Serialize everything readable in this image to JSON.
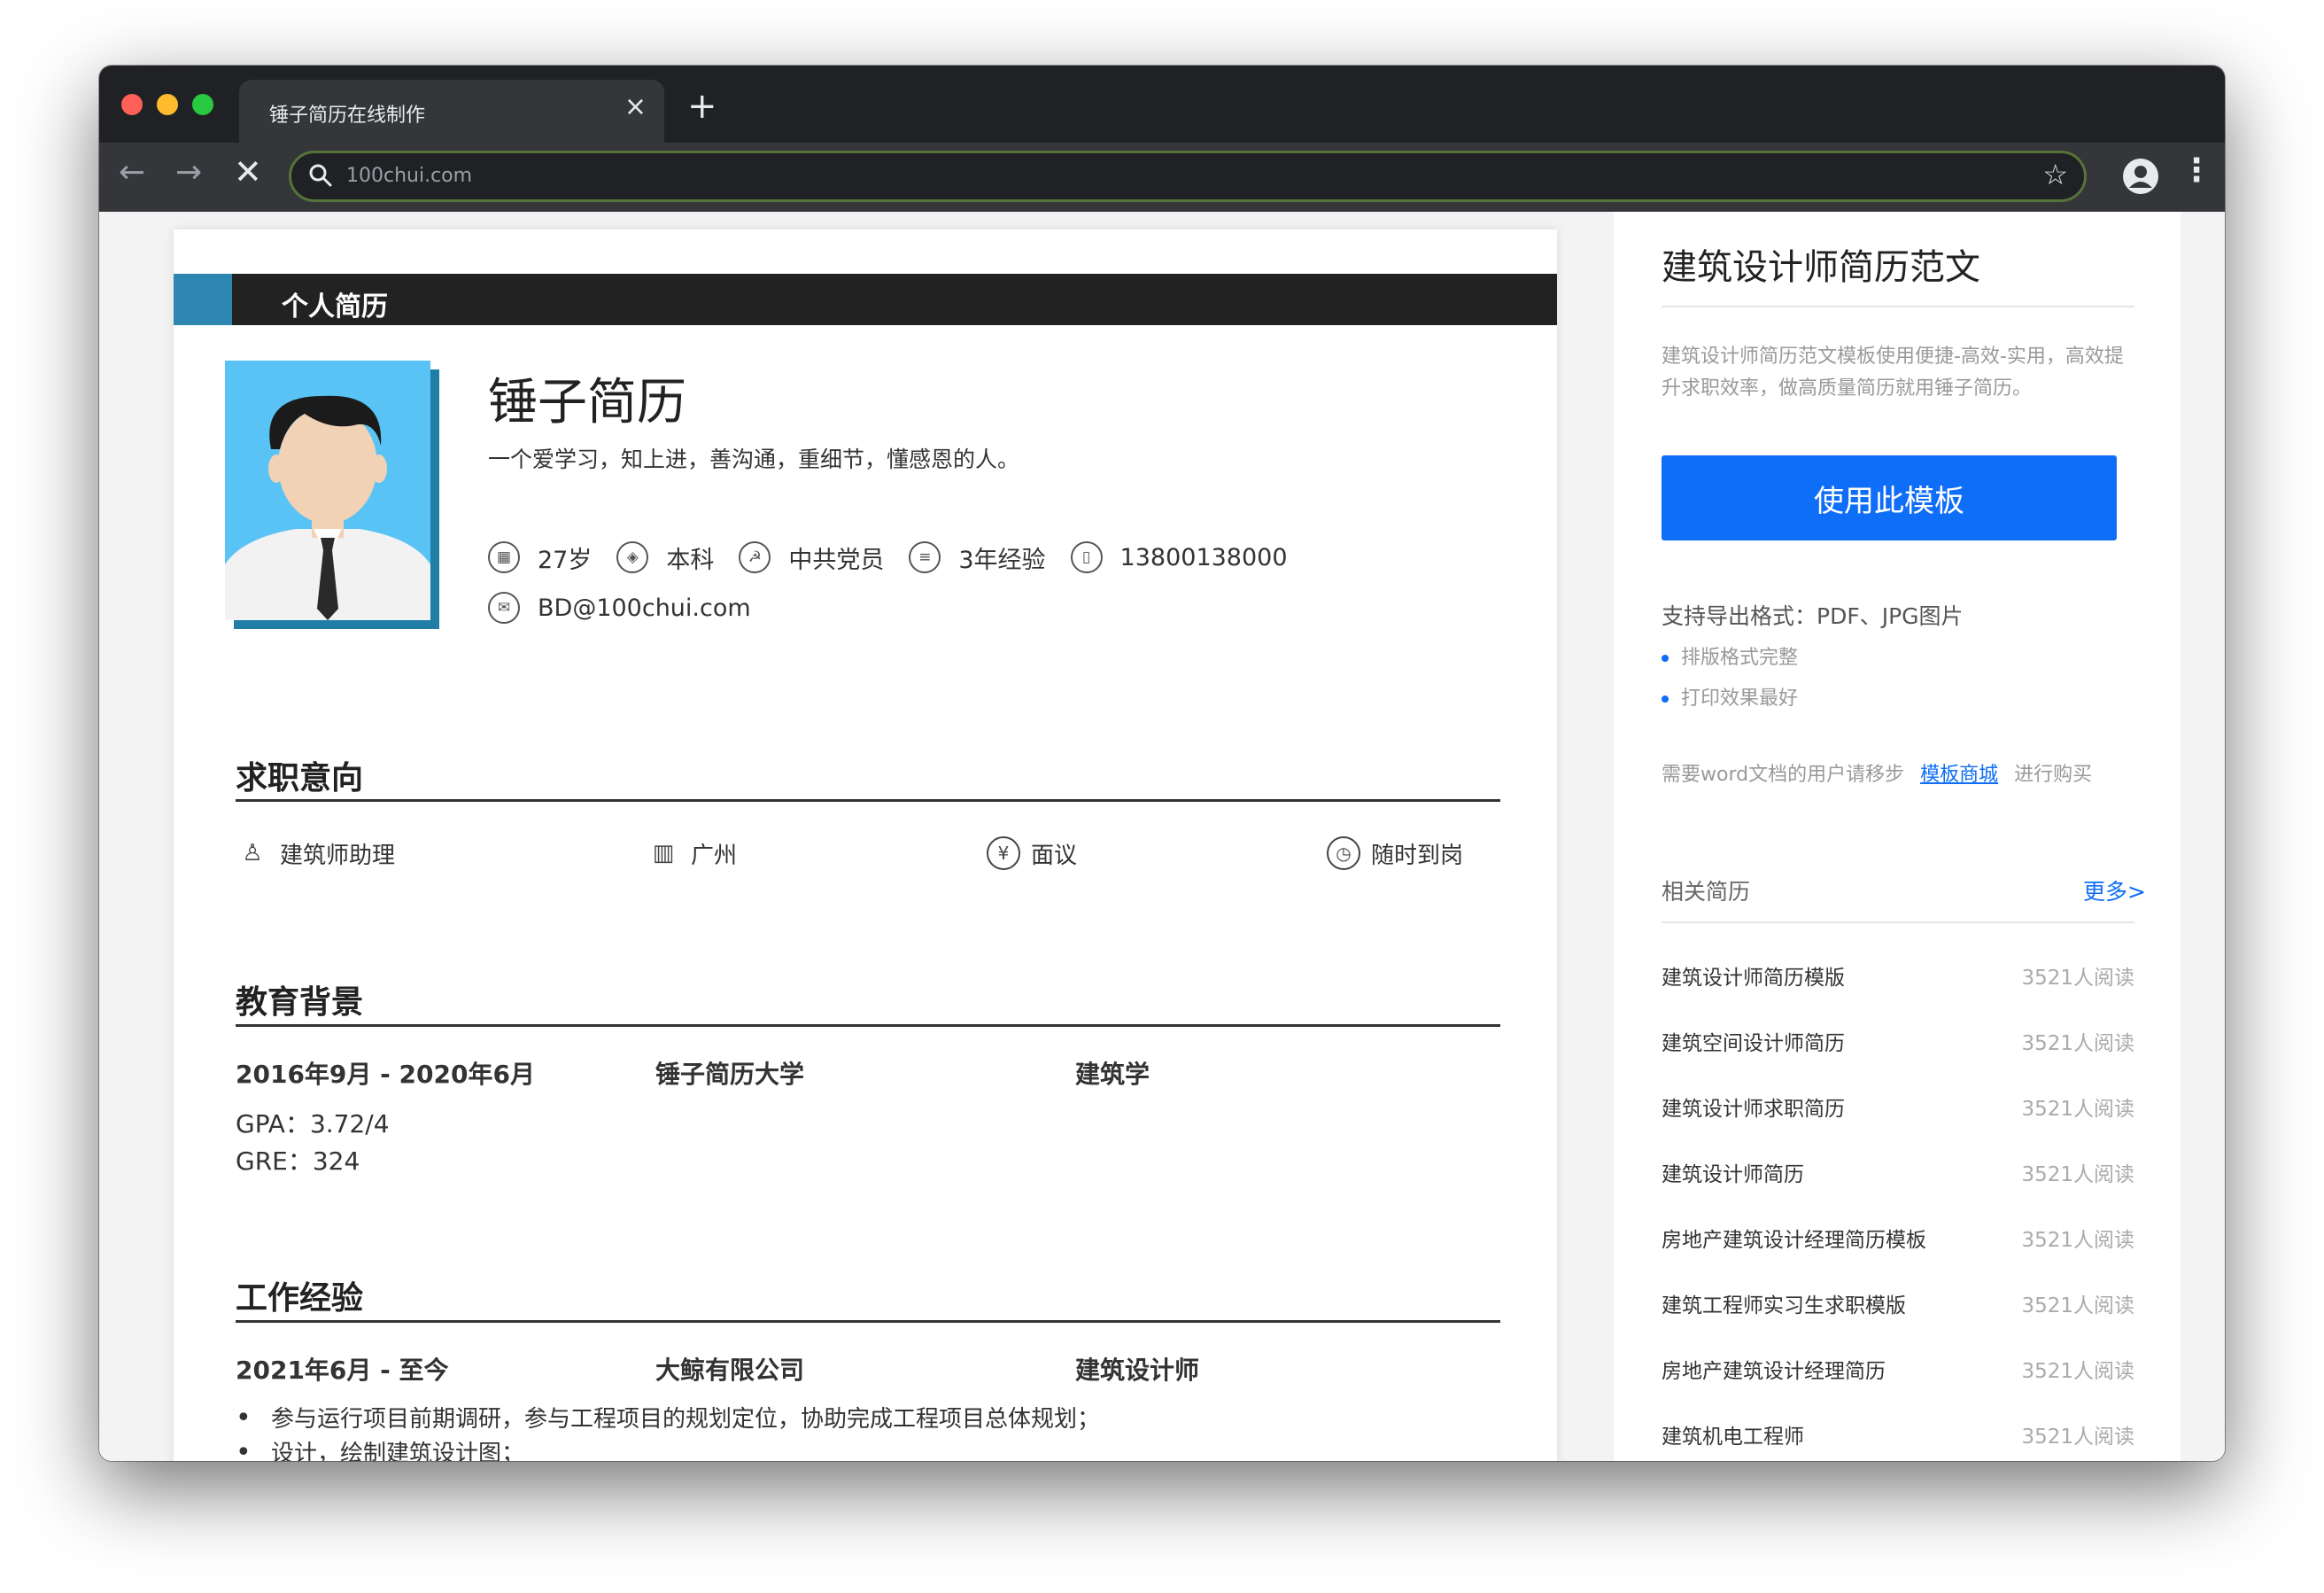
{
  "browser": {
    "tab_title": "锤子简历在线制作",
    "tab_close": "×",
    "new_tab": "+",
    "url": "100chui.com",
    "back": "←",
    "forward": "→",
    "stop": "✕",
    "star": "☆",
    "menu": "⋮"
  },
  "resume": {
    "banner_title": "个人简历",
    "name": "锤子简历",
    "motto": "一个爱学习，知上进，善沟通，重细节，懂感恩的人。",
    "info": {
      "age": "27岁",
      "degree": "本科",
      "politics": "中共党员",
      "experience": "3年经验",
      "phone": "13800138000",
      "email": "BD@100chui.com"
    },
    "sections": {
      "intent": "求职意向",
      "education": "教育背景",
      "work": "工作经验"
    },
    "intent": {
      "position": "建筑师助理",
      "city": "广州",
      "salary": "面议",
      "availability": "随时到岗"
    },
    "education": {
      "period": "2016年9月 - 2020年6月",
      "school": "锤子简历大学",
      "major": "建筑学",
      "gpa": "GPA：3.72/4",
      "gre": "GRE：324"
    },
    "work": {
      "period": "2021年6月 - 至今",
      "company": "大鲸有限公司",
      "title": "建筑设计师",
      "duties": [
        "参与运行项目前期调研，参与工程项目的规划定位，协助完成工程项目总体规划；",
        "设计，绘制建筑设计图；"
      ]
    }
  },
  "sidebar": {
    "title": "建筑设计师简历范文",
    "description": "建筑设计师简历范文模板使用便捷-高效-实用，高效提升求职效率，做高质量简历就用锤子简历。",
    "use_button": "使用此模板",
    "export_formats": "支持导出格式：PDF、JPG图片",
    "features": [
      "排版格式完整",
      "打印效果最好"
    ],
    "word_note_prefix": "需要word文档的用户请移步",
    "word_note_link": "模板商城",
    "word_note_suffix": "进行购买",
    "related_heading": "相关简历",
    "more_link": "更多>",
    "related": [
      {
        "title": "建筑设计师简历模版",
        "count": "3521人阅读"
      },
      {
        "title": "建筑空间设计师简历",
        "count": "3521人阅读"
      },
      {
        "title": "建筑设计师求职简历",
        "count": "3521人阅读"
      },
      {
        "title": "建筑设计师简历",
        "count": "3521人阅读"
      },
      {
        "title": "房地产建筑设计经理简历模板",
        "count": "3521人阅读"
      },
      {
        "title": "建筑工程师实习生求职模版",
        "count": "3521人阅读"
      },
      {
        "title": "房地产建筑设计经理简历",
        "count": "3521人阅读"
      },
      {
        "title": "建筑机电工程师",
        "count": "3521人阅读"
      }
    ]
  },
  "colors": {
    "accent_blue": "#2e87b0",
    "photo_bg": "#5ac3f5",
    "button_blue": "#0f6ef7",
    "banner_dark": "#222222"
  }
}
